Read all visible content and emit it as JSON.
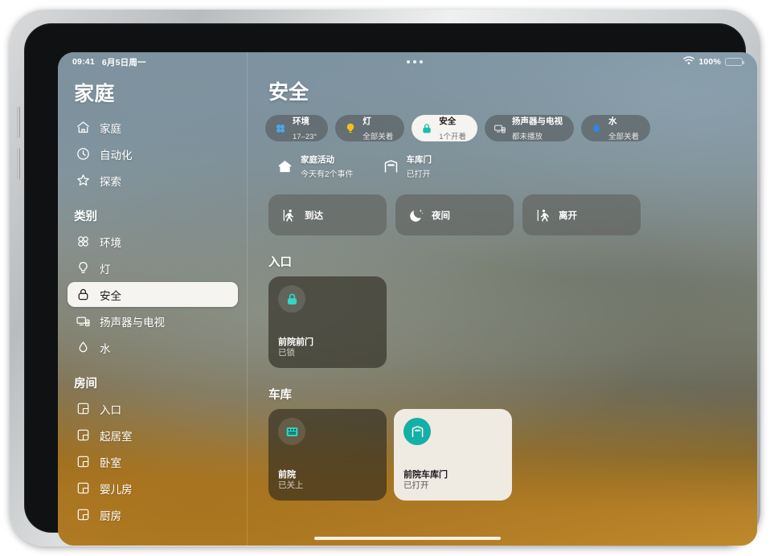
{
  "status_bar": {
    "time": "09:41",
    "date": "6月5日周一",
    "wifi_icon": "wifi-icon",
    "battery_percent": "100%",
    "battery_icon": "battery-icon",
    "multitask_icon": "multitask-dots-icon"
  },
  "sidebar": {
    "title": "家庭",
    "primary_items": [
      {
        "label": "家庭",
        "icon": "house-icon",
        "selected": false
      },
      {
        "label": "自动化",
        "icon": "clock-icon",
        "selected": false
      },
      {
        "label": "探索",
        "icon": "star-icon",
        "selected": false
      }
    ],
    "categories_label": "类别",
    "category_items": [
      {
        "label": "环境",
        "icon": "fan-icon",
        "selected": false
      },
      {
        "label": "灯",
        "icon": "lightbulb-icon",
        "selected": false
      },
      {
        "label": "安全",
        "icon": "lock-icon",
        "selected": true
      },
      {
        "label": "扬声器与电视",
        "icon": "speaker-tv-icon",
        "selected": false
      },
      {
        "label": "水",
        "icon": "water-drop-icon",
        "selected": false
      }
    ],
    "rooms_label": "房间",
    "room_items": [
      {
        "label": "入口",
        "icon": "room-icon",
        "selected": false
      },
      {
        "label": "起居室",
        "icon": "room-icon",
        "selected": false
      },
      {
        "label": "卧室",
        "icon": "room-icon",
        "selected": false
      },
      {
        "label": "婴儿房",
        "icon": "room-icon",
        "selected": false
      },
      {
        "label": "厨房",
        "icon": "room-icon",
        "selected": false
      }
    ]
  },
  "content": {
    "page_title": "安全",
    "status_chips": [
      {
        "title": "环境",
        "subtitle": "17–23°",
        "icon": "fan-icon",
        "icon_color": "#49a8e8",
        "active": false
      },
      {
        "title": "灯",
        "subtitle": "全部关着",
        "icon": "lightbulb-icon",
        "icon_color": "#f3c218",
        "active": false
      },
      {
        "title": "安全",
        "subtitle": "1个开着",
        "icon": "lock-icon",
        "icon_color": "#17bfae",
        "active": true
      },
      {
        "title": "扬声器与电视",
        "subtitle": "都未播放",
        "icon": "speaker-tv-icon",
        "icon_color": "#e9e9ea",
        "active": false
      },
      {
        "title": "水",
        "subtitle": "全部关着",
        "icon": "water-drop-icon",
        "icon_color": "#2f88e8",
        "active": false
      }
    ],
    "summary_items": [
      {
        "title": "家庭活动",
        "subtitle": "今天有2个事件",
        "icon": "house-icon"
      },
      {
        "title": "车库门",
        "subtitle": "已打开",
        "icon": "garage-door-icon"
      }
    ],
    "scenes": [
      {
        "label": "到达",
        "icon": "person-arrive-icon"
      },
      {
        "label": "夜间",
        "icon": "moon-stars-icon"
      },
      {
        "label": "离开",
        "icon": "person-leave-icon"
      }
    ],
    "room_sections": [
      {
        "heading": "入口",
        "tiles": [
          {
            "name": "前院前门",
            "state": "已锁",
            "icon": "lock-icon",
            "icon_color": "#2fd9c4",
            "on": false
          }
        ]
      },
      {
        "heading": "车库",
        "tiles": [
          {
            "name": "前院",
            "state": "已关上",
            "icon": "garage-closed-icon",
            "icon_color": "#2fd9c4",
            "on": false
          },
          {
            "name": "前院车库门",
            "state": "已打开",
            "icon": "garage-open-icon",
            "icon_color": "#ffffff",
            "on": true
          }
        ]
      }
    ]
  },
  "home_indicator": {
    "name": "home-indicator"
  },
  "theme": {
    "accent_teal": "#14b0a6",
    "active_tile_bg": "#efeae2",
    "sidebar_selected_bg": "#f6f4f0"
  }
}
